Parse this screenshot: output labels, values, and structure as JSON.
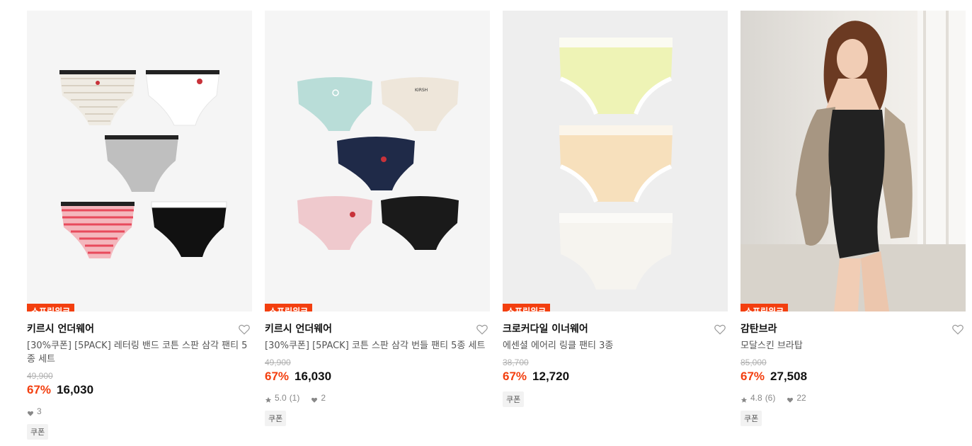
{
  "products": [
    {
      "badge": "스프링위크",
      "brand": "키르시 언더웨어",
      "name": "[30%쿠폰] [5PACK] 레터링 밴드 코튼 스판 삼각 팬티 5종 세트",
      "original_price": "49,900",
      "discount": "67%",
      "price": "16,030",
      "likes": "3",
      "tag": "쿠폰"
    },
    {
      "badge": "스프링위크",
      "brand": "키르시 언더웨어",
      "name": "[30%쿠폰] [5PACK] 코튼 스판 삼각 번들 팬티 5종 세트",
      "original_price": "49,900",
      "discount": "67%",
      "price": "16,030",
      "rating": "5.0",
      "reviews": "(1)",
      "likes": "2",
      "tag": "쿠폰"
    },
    {
      "badge": "스프링위크",
      "brand": "크로커다일 이너웨어",
      "name": "에센셜 에어리 링클 팬티 3종",
      "original_price": "38,700",
      "discount": "67%",
      "price": "12,720",
      "tag": "쿠폰"
    },
    {
      "badge": "스프링위크",
      "brand": "감탄브라",
      "name": "모달스킨 브라탑",
      "original_price": "85,000",
      "discount": "67%",
      "price": "27,508",
      "rating": "4.8",
      "reviews": "(6)",
      "likes": "22",
      "tag": "쿠폰"
    }
  ],
  "product_images": {
    "p1": "five-pack-cotton-briefs",
    "p2": "five-bundle-briefs",
    "p3": "three-wrinkle-briefs",
    "p4": "model-wearing-bra-top"
  },
  "colors": {
    "accent": "#f33f0f",
    "strike": "#b0b0b0",
    "muted": "#888888"
  },
  "icons": {
    "wishlist": "heart-outline-icon",
    "rating": "star-icon",
    "likes": "heart-filled-icon"
  }
}
